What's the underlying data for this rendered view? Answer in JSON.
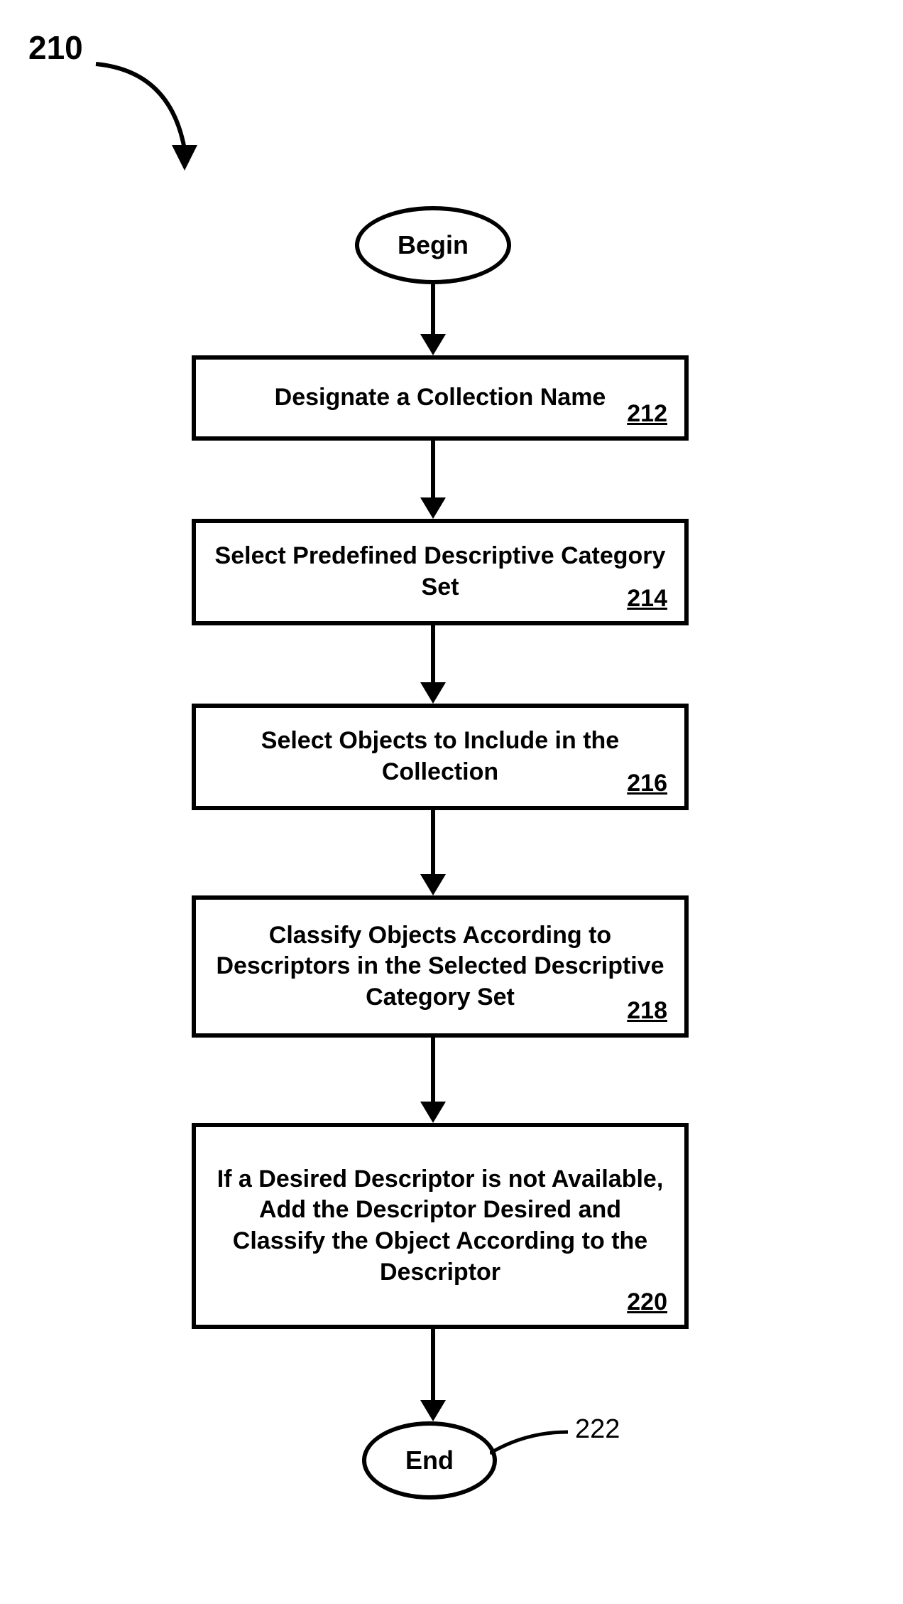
{
  "figure_number_label": "210",
  "terminal_begin": "Begin",
  "terminal_end": "End",
  "end_ref": "222",
  "steps": [
    {
      "text": "Designate a Collection Name",
      "num": "212"
    },
    {
      "text": "Select Predefined Descriptive Category Set",
      "num": "214"
    },
    {
      "text": "Select Objects to Include in the Collection",
      "num": "216"
    },
    {
      "text": "Classify Objects According to Descriptors in the Selected Descriptive Category Set",
      "num": "218"
    },
    {
      "text": "If a Desired Descriptor is not Available, Add the Descriptor Desired and Classify the Object According to the Descriptor",
      "num": "220"
    }
  ]
}
